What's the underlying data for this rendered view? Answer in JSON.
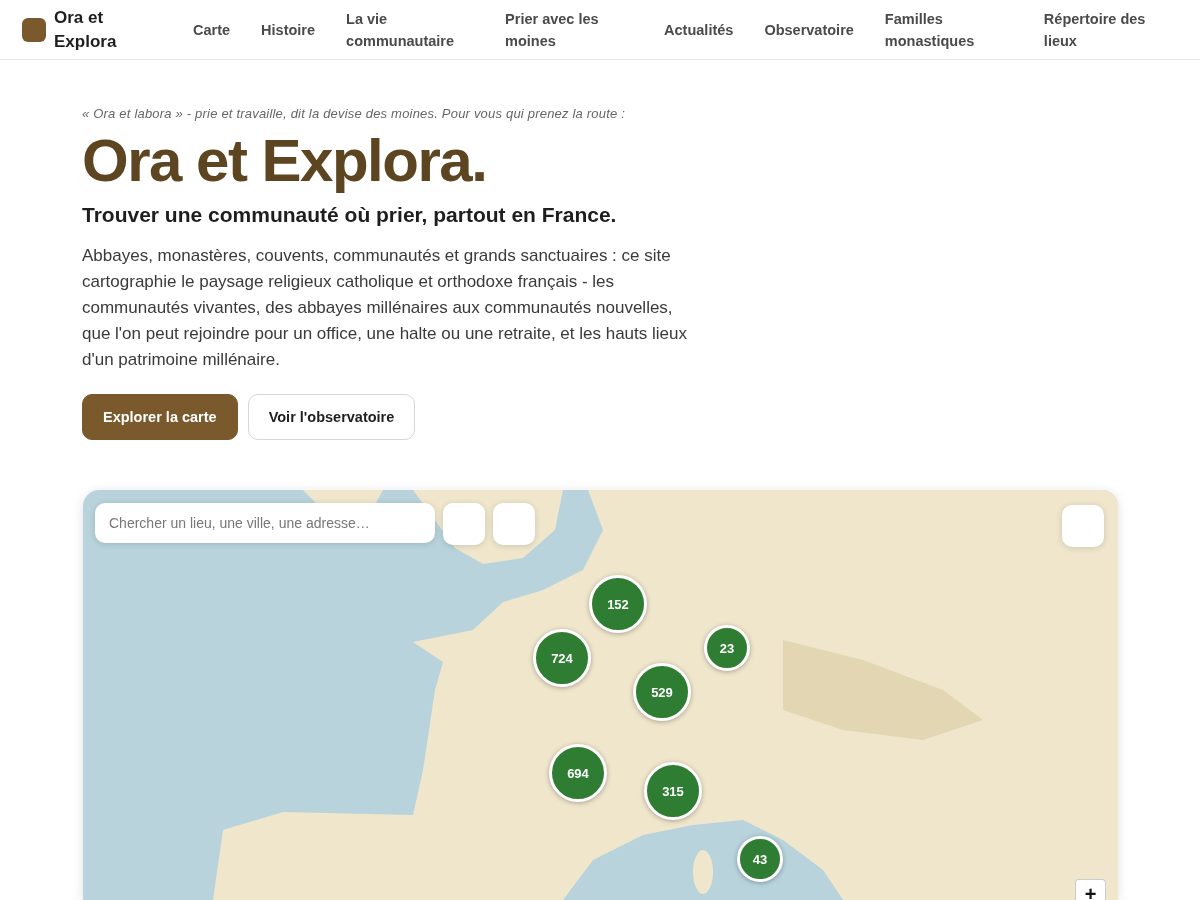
{
  "header": {
    "brand": "Ora et Explora",
    "nav": [
      {
        "label": "Carte"
      },
      {
        "label": "Histoire"
      },
      {
        "label": "La vie communautaire"
      },
      {
        "label": "Prier avec les moines"
      },
      {
        "label": "Actualités"
      },
      {
        "label": "Observatoire"
      },
      {
        "label": "Familles monastiques"
      },
      {
        "label": "Répertoire des lieux"
      }
    ]
  },
  "hero": {
    "tagline": "« Ora et labora » - prie et travaille, dit la devise des moines. Pour vous qui prenez la route :",
    "title": "Ora et Explora.",
    "subtitle": "Trouver une communauté où prier, partout en France.",
    "description": "Abbayes, monastères, couvents, communautés et grands sanctuaires : ce site cartographie le paysage religieux catholique et orthodoxe français - les communautés vivantes, des abbayes millénaires aux communautés nouvelles, que l'on peut rejoindre pour un office, une halte ou une retraite, et les hauts lieux d'un patrimoine millénaire.",
    "buttons": [
      {
        "label": "Explorer la carte",
        "kind": "primary"
      },
      {
        "label": "Voir l'observatoire",
        "kind": "secondary"
      }
    ]
  },
  "map": {
    "search": {
      "placeholder": "Chercher un lieu, une ville, une adresse…"
    },
    "clusters": [
      {
        "count": "152",
        "kind": "large"
      },
      {
        "count": "724",
        "kind": "large"
      },
      {
        "count": "23",
        "kind": "small"
      },
      {
        "count": "529",
        "kind": "large"
      },
      {
        "count": "694",
        "kind": "large"
      },
      {
        "count": "315",
        "kind": "large"
      },
      {
        "count": "43",
        "kind": "small"
      }
    ],
    "zoom_in": "+"
  }
}
